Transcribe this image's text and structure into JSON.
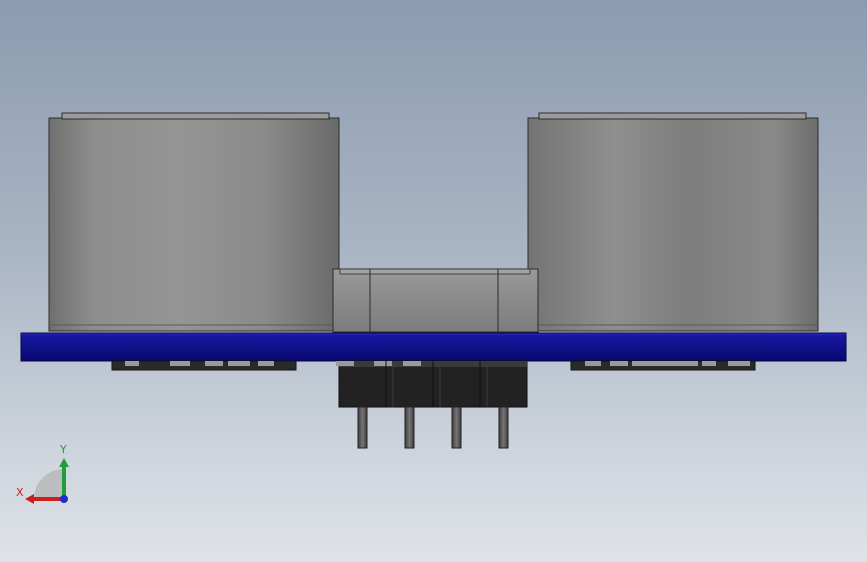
{
  "viewport": {
    "background_top": "#8c9bb0",
    "background_bottom": "#dfe3e8",
    "model_colors": {
      "pcb": "#0c0c8e",
      "transducer": "#8a8a8a",
      "header": "#1e1e1e",
      "pins": "#5c5c5c"
    }
  },
  "triad": {
    "x_label": "X",
    "y_label": "Y",
    "x_color": "#cc1f1f",
    "y_color": "#1f9e3a",
    "z_color": "#1f2ec8"
  }
}
